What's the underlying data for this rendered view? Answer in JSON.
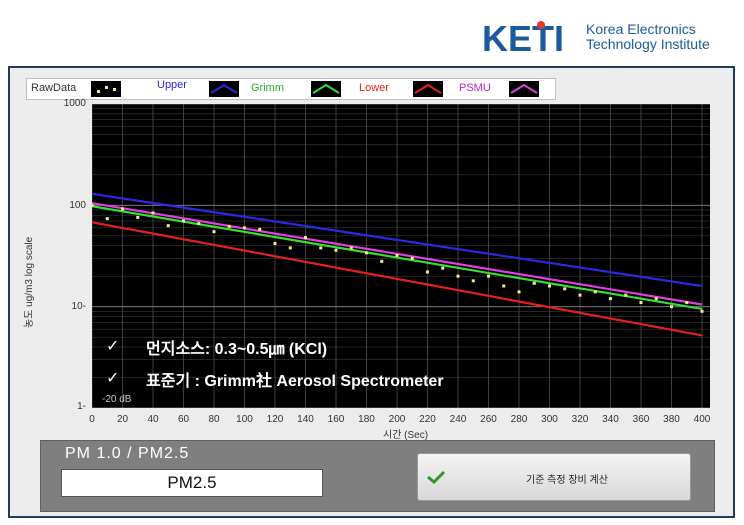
{
  "logo": {
    "mark": "KETI",
    "line1": "Korea Electronics",
    "line2": "Technology Institute"
  },
  "legend": [
    {
      "label": "RawData",
      "color": "#333333"
    },
    {
      "label": "Upper",
      "color": "#1f1fd8"
    },
    {
      "label": "Grimm",
      "color": "#22aa22"
    },
    {
      "label": "Lower",
      "color": "#e02020"
    },
    {
      "label": "PSMU",
      "color": "#c020c0"
    }
  ],
  "chart_data": {
    "type": "scatter",
    "ylabel": "농도 ug/m3   log scale",
    "xlabel": "시간 (Sec)",
    "x_ticks": [
      "0",
      "20",
      "40",
      "60",
      "80",
      "100",
      "120",
      "140",
      "160",
      "180",
      "200",
      "220",
      "240",
      "260",
      "280",
      "300",
      "320",
      "340",
      "360",
      "380",
      "400"
    ],
    "y_ticks": [
      "1000",
      "100",
      "10-",
      "1-"
    ],
    "y_scale": "log",
    "ylim": [
      1,
      1000
    ],
    "xlim": [
      0,
      400
    ],
    "grid": true,
    "min_label": "-20 dB",
    "series": [
      {
        "name": "Upper",
        "color": "#2a2ae0",
        "x": [
          0,
          400
        ],
        "y": [
          130,
          16
        ]
      },
      {
        "name": "Grimm",
        "color": "#33e033",
        "x": [
          0,
          400
        ],
        "y": [
          98,
          9.5
        ]
      },
      {
        "name": "Lower",
        "color": "#e62020",
        "x": [
          0,
          400
        ],
        "y": [
          68,
          5.2
        ]
      },
      {
        "name": "PSMU",
        "color": "#e040e0",
        "x": [
          0,
          400
        ],
        "y": [
          105,
          10.5
        ]
      },
      {
        "name": "RawData",
        "color": "#f0f080",
        "x": [
          0,
          10,
          20,
          30,
          40,
          50,
          60,
          70,
          80,
          90,
          100,
          110,
          120,
          130,
          140,
          150,
          160,
          170,
          180,
          190,
          200,
          210,
          220,
          230,
          240,
          250,
          260,
          270,
          280,
          290,
          300,
          310,
          320,
          330,
          340,
          350,
          360,
          370,
          380,
          390,
          400
        ],
        "y": [
          100,
          74,
          92,
          76,
          84,
          63,
          70,
          66,
          55,
          62,
          60,
          58,
          42,
          38,
          48,
          38,
          36,
          38,
          34,
          28,
          32,
          30,
          22,
          24,
          20,
          18,
          20,
          16,
          14,
          17,
          16,
          15,
          13,
          14,
          12,
          13,
          11,
          12,
          10,
          11,
          9
        ]
      }
    ]
  },
  "notes": {
    "line1": "먼지소스: 0.3~0.5㎛ (KCl)",
    "line2": "표준기 : Grimm社 Aerosol Spectrometer",
    "check": "✓"
  },
  "pm": {
    "title": "PM 1.0  /  PM2.5",
    "value": "PM2.5"
  },
  "button": {
    "label": "기준 측정 장비 계산"
  }
}
